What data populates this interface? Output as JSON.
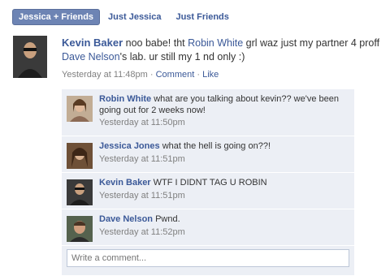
{
  "tabs": [
    {
      "label": "Jessica + Friends",
      "active": true
    },
    {
      "label": "Just Jessica",
      "active": false
    },
    {
      "label": "Just Friends",
      "active": false
    }
  ],
  "story": {
    "author": "Kevin Baker",
    "text_parts": [
      {
        "t": "noo babe! tht ",
        "link": false
      },
      {
        "t": "Robin White",
        "link": true
      },
      {
        "t": " grl waz just my partner 4 proff ",
        "link": false
      },
      {
        "t": "Dave Nelson",
        "link": true
      },
      {
        "t": "'s lab. ur still my 1 nd only :)",
        "link": false
      }
    ],
    "time": "Yesterday at 11:48pm",
    "sep": "·",
    "comment_label": "Comment",
    "like_label": "Like"
  },
  "comments": [
    {
      "name": "Robin White",
      "text": "what are you talking about kevin?? we've been going out for 2 weeks now!",
      "time": "Yesterday at 11:50pm"
    },
    {
      "name": "Jessica Jones",
      "text": "what the hell is going on??!",
      "time": "Yesterday at 11:51pm"
    },
    {
      "name": "Kevin Baker",
      "text": "WTF I DIDNT TAG U ROBIN",
      "time": "Yesterday at 11:51pm"
    },
    {
      "name": "Dave Nelson",
      "text": "Pwnd.",
      "time": "Yesterday at 11:52pm"
    }
  ],
  "write_comment": {
    "placeholder": "Write a comment..."
  },
  "colors": {
    "link": "#3b5998",
    "tab_active_bg": "#6d84b4",
    "comment_bg": "#eceff5",
    "meta": "#808080"
  }
}
